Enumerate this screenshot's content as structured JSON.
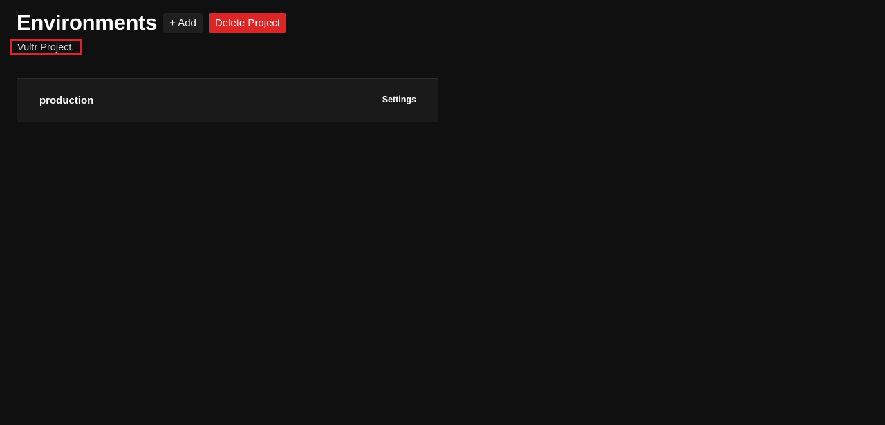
{
  "header": {
    "title": "Environments",
    "add_label": "+ Add",
    "delete_label": "Delete Project"
  },
  "project": {
    "name": "Vultr Project."
  },
  "environments": [
    {
      "name": "production",
      "settings_label": "Settings"
    }
  ],
  "colors": {
    "background": "#101010",
    "card_background": "#1a1a1a",
    "add_button": "#1f1f1f",
    "delete_button": "#dc2626",
    "highlight_border": "#e0242b"
  }
}
